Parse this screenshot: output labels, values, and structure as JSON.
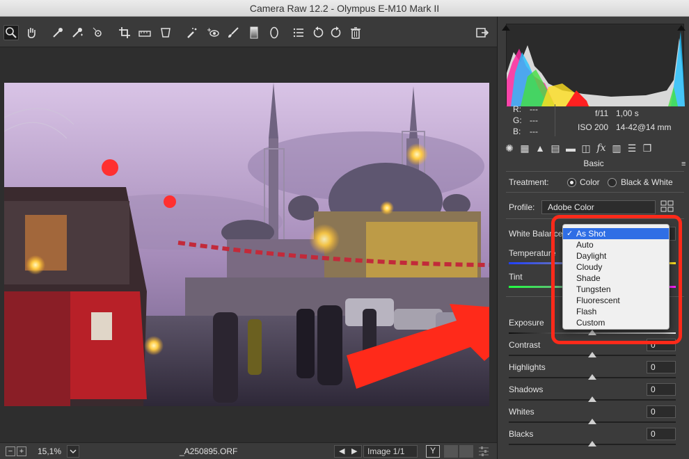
{
  "window": {
    "title": "Camera Raw 12.2  -  Olympus E-M10 Mark II"
  },
  "toolbar": {
    "tools": [
      {
        "name": "zoom-tool-icon"
      },
      {
        "name": "hand-tool-icon"
      },
      {
        "name": "white-balance-tool-icon"
      },
      {
        "name": "color-sampler-tool-icon"
      },
      {
        "name": "targeted-adjustment-tool-icon"
      },
      {
        "name": "crop-tool-icon"
      },
      {
        "name": "straighten-tool-icon"
      },
      {
        "name": "transform-tool-icon"
      },
      {
        "name": "spot-removal-tool-icon"
      },
      {
        "name": "red-eye-tool-icon"
      },
      {
        "name": "adjustment-brush-icon"
      },
      {
        "name": "graduated-filter-icon"
      },
      {
        "name": "radial-filter-icon"
      },
      {
        "name": "preferences-icon"
      },
      {
        "name": "rotate-left-icon"
      },
      {
        "name": "rotate-right-icon"
      },
      {
        "name": "trash-icon"
      }
    ]
  },
  "bottombar": {
    "zoom": "15,1%",
    "filename": "_A250895.ORF",
    "image_count": "Image 1/1",
    "y_button": "Y"
  },
  "info": {
    "r_label": "R:",
    "r_val": "---",
    "g_label": "G:",
    "g_val": "---",
    "b_label": "B:",
    "b_val": "---",
    "aperture": "f/11",
    "shutter": "1,00 s",
    "iso": "ISO 200",
    "lens": "14-42@14 mm"
  },
  "basic": {
    "section_title": "Basic",
    "treatment_label": "Treatment:",
    "color_label": "Color",
    "bw_label": "Black & White",
    "treatment_selected": "Color",
    "profile_label": "Profile:",
    "profile_value": "Adobe Color",
    "white_balance_label": "White Balance:",
    "temperature_label": "Temperature",
    "tint_label": "Tint",
    "exposure_label": "Exposure",
    "sliders": [
      {
        "label": "Contrast",
        "value": "0"
      },
      {
        "label": "Highlights",
        "value": "0"
      },
      {
        "label": "Shadows",
        "value": "0"
      },
      {
        "label": "Whites",
        "value": "0"
      },
      {
        "label": "Blacks",
        "value": "0"
      }
    ]
  },
  "white_balance_menu": {
    "selected": "As Shot",
    "options": [
      "As Shot",
      "Auto",
      "Daylight",
      "Cloudy",
      "Shade",
      "Tungsten",
      "Fluorescent",
      "Flash",
      "Custom"
    ]
  },
  "colors": {
    "highlight_red": "#ff2a1a",
    "menu_selection": "#2f6ee5",
    "panel_bg": "#3b3b3b",
    "toolbar_bg": "#3a3a3a"
  }
}
